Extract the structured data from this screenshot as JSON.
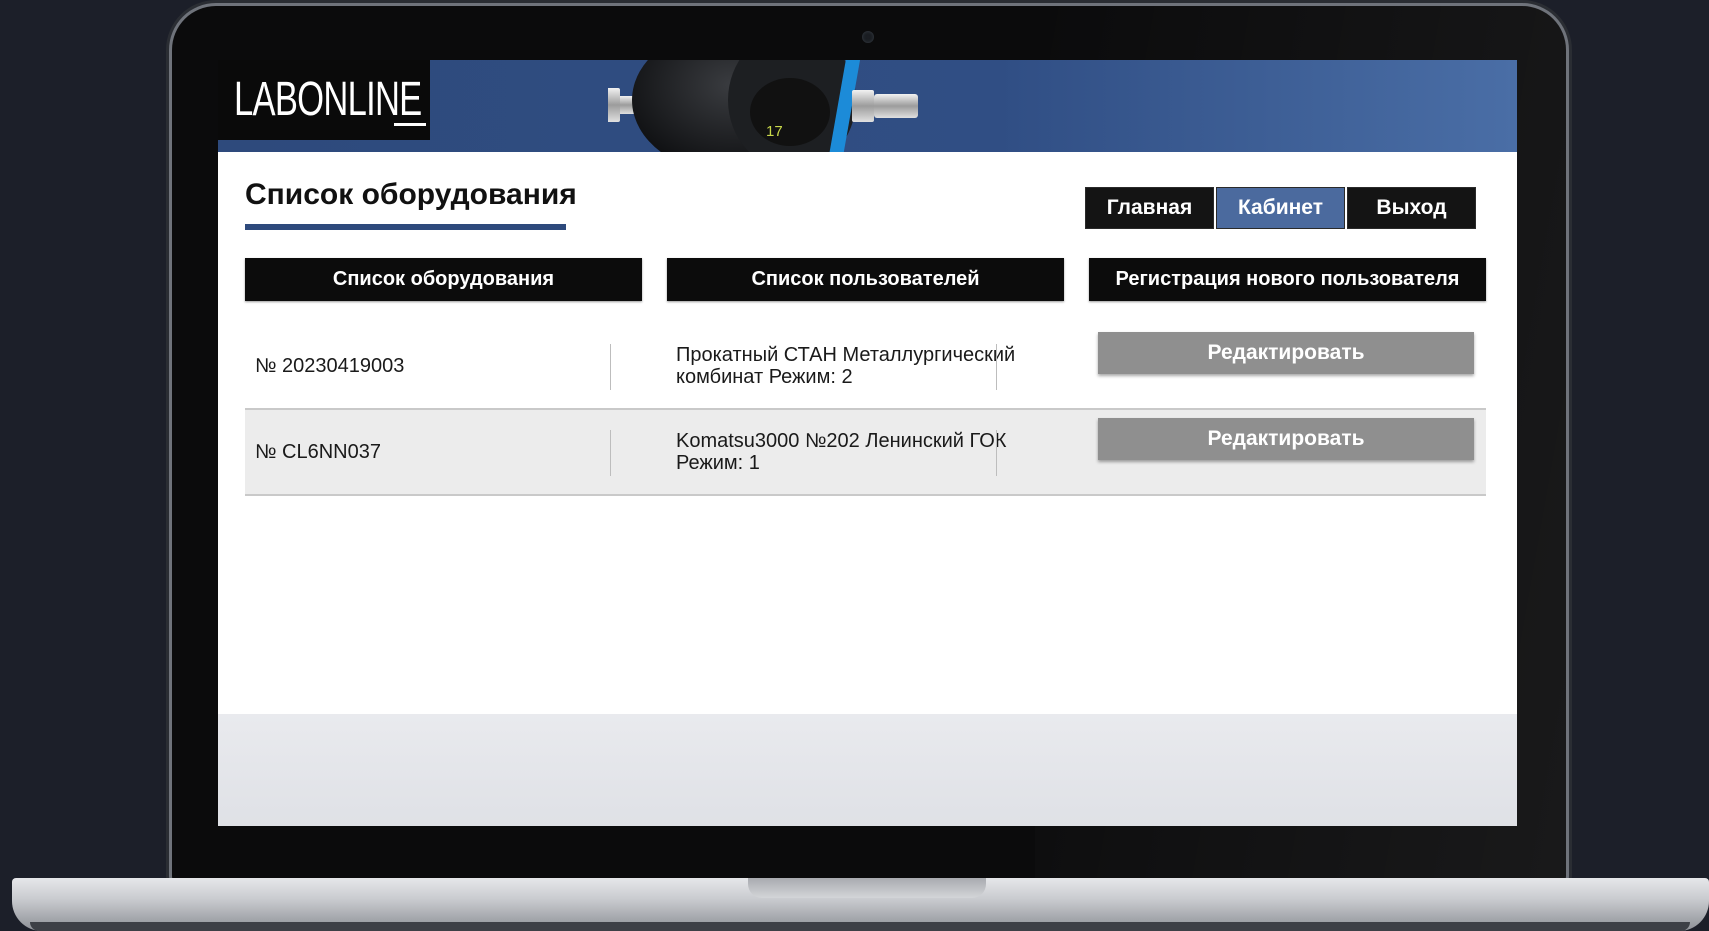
{
  "brand": {
    "logo_text": "LABONLINE"
  },
  "header": {
    "page_title": "Список оборудования"
  },
  "topnav": {
    "items": [
      {
        "label": "Главная",
        "active": false
      },
      {
        "label": "Кабинет",
        "active": true
      },
      {
        "label": "Выход",
        "active": false
      }
    ]
  },
  "tabs": [
    {
      "label": "Список оборудования"
    },
    {
      "label": "Список пользователей"
    },
    {
      "label": "Регистрация нового пользователя"
    }
  ],
  "equipment": [
    {
      "id": "№ 20230419003",
      "description": "Прокатный СТАН Металлургический комбинат Режим: 2",
      "action": "Редактировать"
    },
    {
      "id": "№ CL6NN037",
      "description": "Komatsu3000 №202 Ленинский ГОК Режим: 1",
      "action": "Редактировать"
    }
  ],
  "device_display_value": "17",
  "colors": {
    "brand_blue": "#2e4a7c",
    "active_nav": "#4b6a9e",
    "button_dark": "#0c0c0c",
    "edit_button": "#8f8f8f"
  }
}
